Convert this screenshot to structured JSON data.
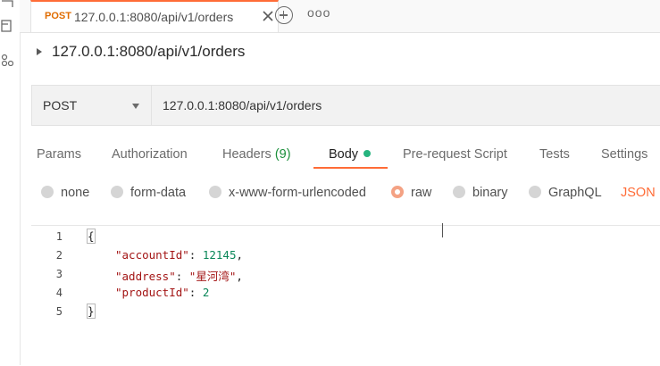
{
  "tab": {
    "method": "POST",
    "title": "127.0.0.1:8080/api/v1/orders",
    "more": "ooo"
  },
  "breadcrumb": {
    "title": "127.0.0.1:8080/api/v1/orders"
  },
  "request": {
    "method": "POST",
    "url": "127.0.0.1:8080/api/v1/orders"
  },
  "subtabs": {
    "params": "Params",
    "authorization": "Authorization",
    "headers": "Headers",
    "headers_count": "(9)",
    "body": "Body",
    "prerequest": "Pre-request Script",
    "tests": "Tests",
    "settings": "Settings"
  },
  "body_types": {
    "none": "none",
    "form_data": "form-data",
    "urlencoded": "x-www-form-urlencoded",
    "raw": "raw",
    "binary": "binary",
    "graphql": "GraphQL",
    "selected": "raw",
    "format": "JSON"
  },
  "editor": {
    "line_numbers": [
      "1",
      "2",
      "3",
      "4",
      "5"
    ],
    "open_brace": "{",
    "close_brace": "}",
    "fields": [
      {
        "key": "\"accountId\"",
        "value": "12145",
        "suffix": ","
      },
      {
        "key": "\"address\"",
        "value": "\"星河湾\"",
        "suffix": ","
      },
      {
        "key": "\"productId\"",
        "value": "2",
        "suffix": ""
      }
    ]
  },
  "colors": {
    "accent": "#ff6c37",
    "method_post": "#e06c00",
    "body_dot": "#26b47f",
    "headers_count": "#1a8f3a"
  }
}
